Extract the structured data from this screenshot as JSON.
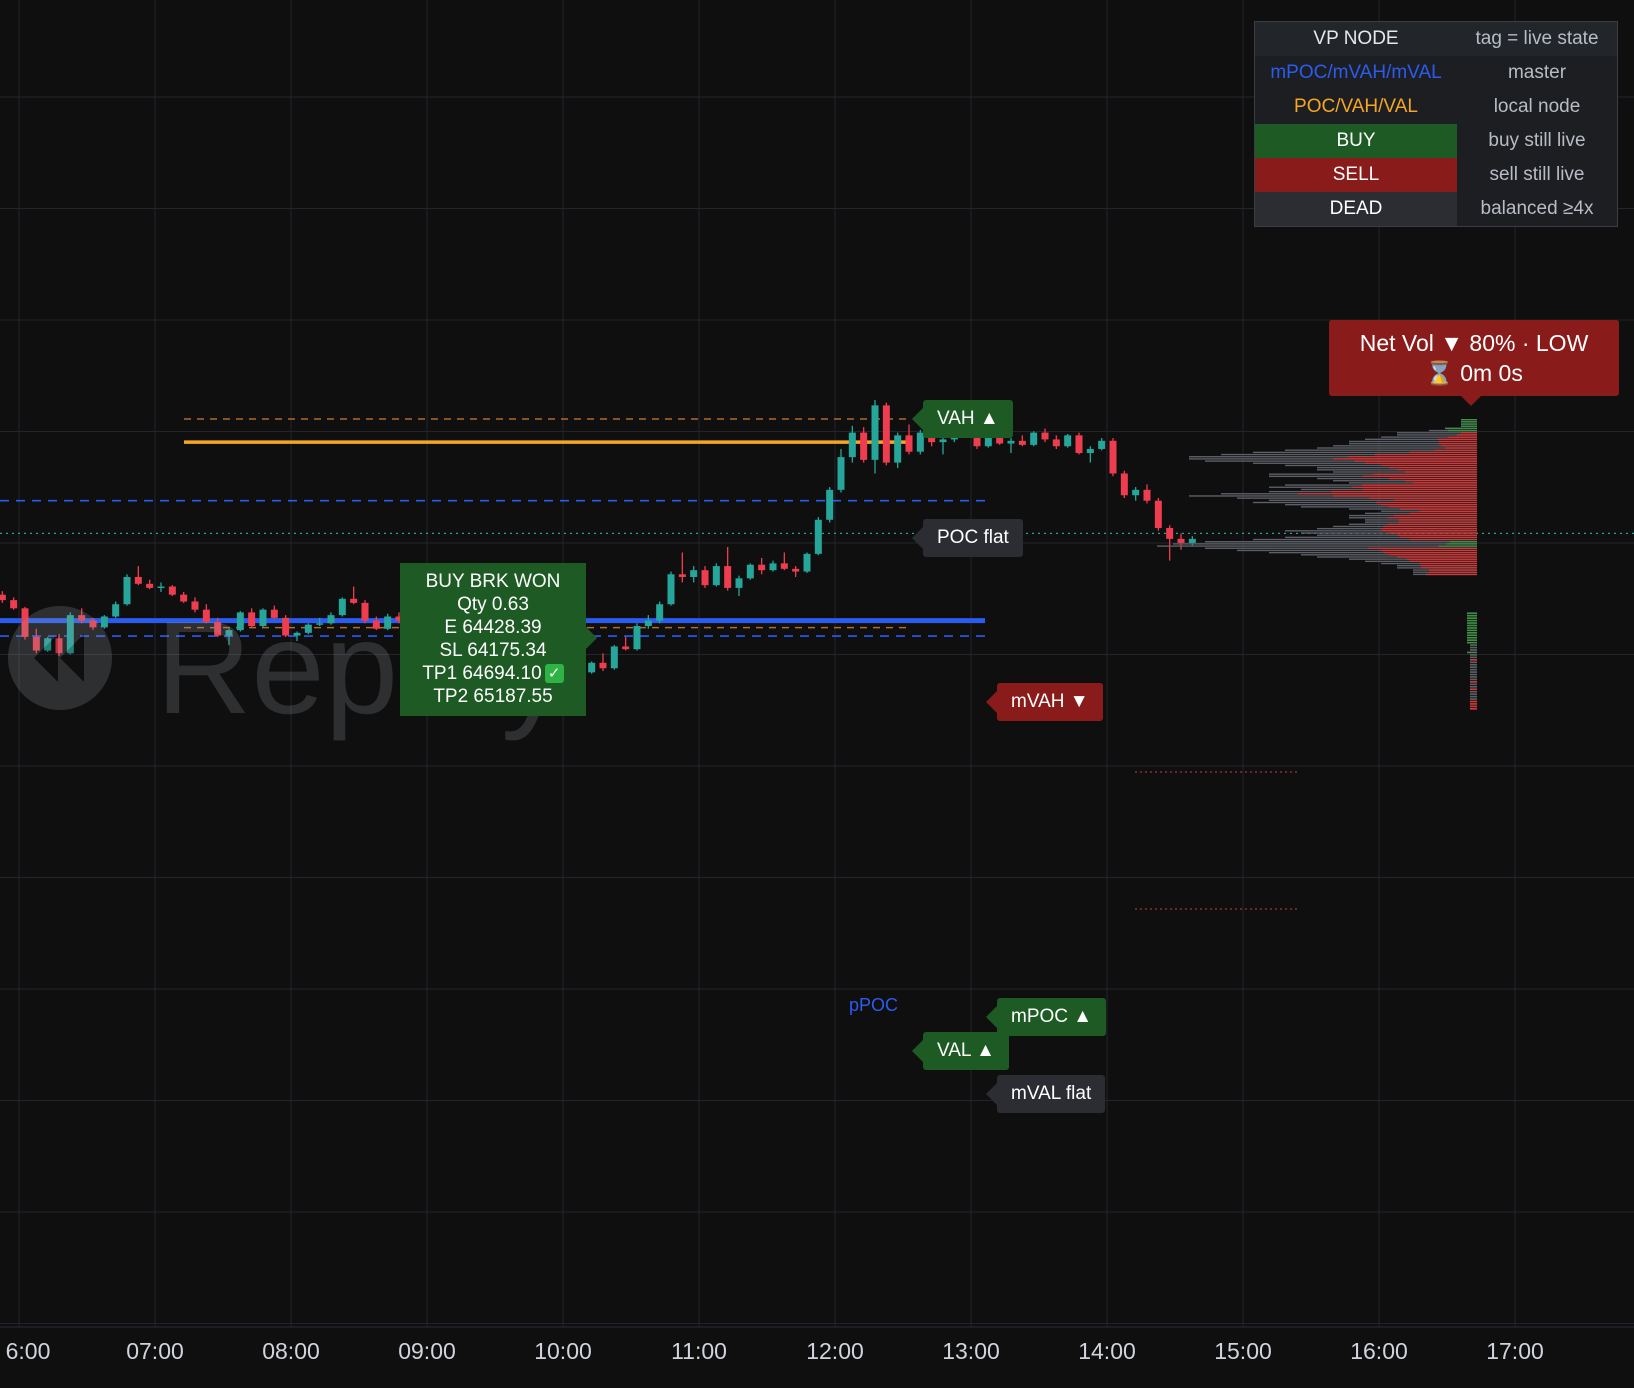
{
  "chart_data": {
    "type": "candlestick",
    "x_ticks": [
      "6:00",
      "07:00",
      "08:00",
      "09:00",
      "10:00",
      "11:00",
      "12:00",
      "13:00",
      "14:00",
      "15:00",
      "16:00",
      "17:00"
    ],
    "bar_interval_minutes": 5,
    "first_bar_time": "05:40",
    "ohlc": [
      [
        64010,
        64012,
        63935,
        63940
      ],
      [
        63940,
        63995,
        63930,
        63985
      ],
      [
        63985,
        63998,
        63955,
        63965
      ],
      [
        63965,
        63975,
        63930,
        63935
      ],
      [
        63935,
        63940,
        63820,
        63830
      ],
      [
        63830,
        63860,
        63770,
        63780
      ],
      [
        63780,
        63830,
        63775,
        63825
      ],
      [
        63825,
        63840,
        63760,
        63770
      ],
      [
        63770,
        63920,
        63765,
        63910
      ],
      [
        63910,
        63935,
        63880,
        63890
      ],
      [
        63890,
        63900,
        63855,
        63865
      ],
      [
        63865,
        63910,
        63860,
        63905
      ],
      [
        63905,
        63960,
        63900,
        63950
      ],
      [
        63950,
        64060,
        63945,
        64050
      ],
      [
        64050,
        64090,
        64020,
        64025
      ],
      [
        64025,
        64040,
        64005,
        64010
      ],
      [
        64010,
        64030,
        63995,
        64015
      ],
      [
        64015,
        64020,
        63980,
        63985
      ],
      [
        63985,
        63995,
        63955,
        63960
      ],
      [
        63960,
        63975,
        63920,
        63930
      ],
      [
        63930,
        63950,
        63880,
        63885
      ],
      [
        63885,
        63900,
        63830,
        63835
      ],
      [
        63835,
        63860,
        63800,
        63855
      ],
      [
        63855,
        63925,
        63850,
        63920
      ],
      [
        63920,
        63935,
        63865,
        63870
      ],
      [
        63870,
        63935,
        63865,
        63930
      ],
      [
        63930,
        63945,
        63895,
        63900
      ],
      [
        63900,
        63910,
        63830,
        63835
      ],
      [
        63835,
        63850,
        63815,
        63845
      ],
      [
        63845,
        63880,
        63840,
        63875
      ],
      [
        63875,
        63900,
        63870,
        63880
      ],
      [
        63880,
        63920,
        63875,
        63910
      ],
      [
        63910,
        63975,
        63905,
        63970
      ],
      [
        63970,
        64015,
        63950,
        63955
      ],
      [
        63955,
        63965,
        63880,
        63890
      ],
      [
        63890,
        63905,
        63855,
        63860
      ],
      [
        63860,
        63915,
        63855,
        63905
      ],
      [
        63905,
        63920,
        63880,
        63890
      ],
      [
        63890,
        63925,
        63885,
        63920
      ],
      [
        63920,
        63960,
        63915,
        63955
      ],
      [
        63955,
        63960,
        63905,
        63910
      ],
      [
        63910,
        63915,
        63855,
        63860
      ],
      [
        63860,
        63870,
        63760,
        63770
      ],
      [
        63770,
        63780,
        63710,
        63720
      ],
      [
        63720,
        63730,
        63640,
        63650
      ],
      [
        63650,
        63660,
        63610,
        63620
      ],
      [
        63620,
        63650,
        63600,
        63640
      ],
      [
        63640,
        63660,
        63610,
        63615
      ],
      [
        63615,
        63640,
        63590,
        63630
      ],
      [
        63630,
        63650,
        63610,
        63615
      ],
      [
        63615,
        63660,
        63610,
        63655
      ],
      [
        63655,
        63670,
        63620,
        63625
      ],
      [
        63625,
        63720,
        63620,
        63715
      ],
      [
        63715,
        63730,
        63690,
        63700
      ],
      [
        63700,
        63740,
        63695,
        63735
      ],
      [
        63735,
        63770,
        63705,
        63715
      ],
      [
        63715,
        63800,
        63710,
        63795
      ],
      [
        63795,
        63830,
        63780,
        63785
      ],
      [
        63785,
        63880,
        63780,
        63870
      ],
      [
        63870,
        63910,
        63860,
        63890
      ],
      [
        63890,
        63960,
        63880,
        63950
      ],
      [
        63950,
        64070,
        63945,
        64060
      ],
      [
        64060,
        64140,
        64030,
        64050
      ],
      [
        64050,
        64090,
        64030,
        64075
      ],
      [
        64075,
        64090,
        64010,
        64020
      ],
      [
        64020,
        64100,
        64015,
        64090
      ],
      [
        64090,
        64160,
        64000,
        64010
      ],
      [
        64010,
        64055,
        63980,
        64045
      ],
      [
        64045,
        64100,
        64040,
        64095
      ],
      [
        64095,
        64120,
        64060,
        64075
      ],
      [
        64075,
        64110,
        64070,
        64100
      ],
      [
        64100,
        64140,
        64075,
        64080
      ],
      [
        64080,
        64090,
        64050,
        64070
      ],
      [
        64070,
        64140,
        64065,
        64135
      ],
      [
        64135,
        64270,
        64130,
        64260
      ],
      [
        64260,
        64380,
        64250,
        64370
      ],
      [
        64370,
        64520,
        64360,
        64490
      ],
      [
        64490,
        64605,
        64470,
        64580
      ],
      [
        64580,
        64600,
        64470,
        64480
      ],
      [
        64480,
        64700,
        64430,
        64680
      ],
      [
        64680,
        64690,
        64460,
        64470
      ],
      [
        64470,
        64580,
        64450,
        64570
      ],
      [
        64570,
        64610,
        64500,
        64510
      ],
      [
        64510,
        64590,
        64500,
        64580
      ],
      [
        64580,
        64595,
        64530,
        64545
      ],
      [
        64545,
        64565,
        64500,
        64555
      ],
      [
        64555,
        64600,
        64545,
        64590
      ],
      [
        64590,
        64620,
        64560,
        64575
      ],
      [
        64575,
        64580,
        64520,
        64530
      ],
      [
        64530,
        64575,
        64525,
        64570
      ],
      [
        64570,
        64600,
        64535,
        64540
      ],
      [
        64540,
        64560,
        64505,
        64550
      ],
      [
        64550,
        64570,
        64530,
        64535
      ],
      [
        64535,
        64585,
        64530,
        64580
      ],
      [
        64580,
        64595,
        64545,
        64555
      ],
      [
        64555,
        64570,
        64520,
        64530
      ],
      [
        64530,
        64575,
        64525,
        64570
      ],
      [
        64570,
        64580,
        64500,
        64505
      ],
      [
        64505,
        64530,
        64470,
        64520
      ],
      [
        64520,
        64560,
        64515,
        64550
      ],
      [
        64550,
        64560,
        64420,
        64430
      ],
      [
        64430,
        64440,
        64340,
        64350
      ],
      [
        64350,
        64380,
        64330,
        64370
      ],
      [
        64370,
        64390,
        64320,
        64330
      ],
      [
        64330,
        64340,
        64220,
        64230
      ],
      [
        64230,
        64240,
        64110,
        64190
      ],
      [
        64190,
        64210,
        64150,
        64175
      ],
      [
        64175,
        64200,
        64165,
        64190
      ]
    ],
    "levels": {
      "VAH": 64630,
      "POC": 64545,
      "mVAH": 64330,
      "pPOC": 63890,
      "mPOC": 63890,
      "VAL": 63864,
      "mVAL": 63833
    },
    "current_price": 64210,
    "volume_profile": {
      "price_top": 64630,
      "price_step": 8,
      "total": [
        1,
        1,
        1,
        1,
        2,
        3,
        5,
        5,
        6,
        7,
        8,
        8,
        9,
        10,
        12,
        14,
        16,
        18,
        18,
        17,
        14,
        12,
        10,
        10,
        9,
        13,
        13,
        10,
        9,
        8,
        12,
        13,
        11,
        13,
        16,
        18,
        15,
        13,
        14,
        12,
        11,
        8,
        6,
        7,
        8,
        8,
        7,
        7,
        8,
        9,
        10,
        12,
        11,
        10,
        12,
        14,
        17,
        19,
        20,
        17,
        15,
        13,
        11,
        10,
        8,
        7,
        6,
        5,
        5,
        4,
        4,
        4
      ],
      "delta_side": [
        "buy",
        "buy",
        "buy",
        "buy",
        "buy",
        "buy",
        "sell",
        "sell",
        "sell",
        "sell",
        "sell",
        "sell",
        "sell",
        "sell",
        "sell",
        "sell",
        "sell",
        "sell",
        "sell",
        "sell",
        "sell",
        "sell",
        "sell",
        "sell",
        "sell",
        "sell",
        "sell",
        "sell",
        "sell",
        "sell",
        "sell",
        "sell",
        "sell",
        "sell",
        "sell",
        "sell",
        "sell",
        "sell",
        "sell",
        "sell",
        "sell",
        "sell",
        "sell",
        "sell",
        "sell",
        "sell",
        "sell",
        "sell",
        "sell",
        "sell",
        "sell",
        "sell",
        "sell",
        "sell",
        "sell",
        "sell",
        "buy",
        "buy",
        "buy",
        "sell",
        "sell",
        "sell",
        "sell",
        "sell",
        "sell",
        "sell",
        "sell",
        "sell",
        "sell",
        "sell",
        "sell",
        "sell"
      ],
      "delta_frac": [
        1,
        1,
        1,
        1,
        1,
        0.6,
        0.2,
        0.25,
        0.3,
        0.35,
        0.3,
        0.3,
        0.25,
        0.2,
        0.22,
        0.3,
        0.4,
        0.45,
        0.5,
        0.45,
        0.5,
        0.5,
        0.55,
        0.5,
        0.5,
        0.5,
        0.55,
        0.55,
        0.5,
        0.5,
        0.6,
        0.6,
        0.65,
        0.7,
        0.7,
        0.5,
        0.45,
        0.4,
        0.45,
        0.5,
        0.5,
        0.6,
        0.6,
        0.6,
        0.65,
        0.7,
        0.7,
        0.7,
        0.7,
        0.65,
        0.6,
        0.5,
        0.5,
        0.5,
        0.4,
        0.3,
        0.1,
        0.1,
        0.12,
        0.4,
        0.4,
        0.45,
        0.5,
        0.5,
        0.55,
        0.6,
        0.6,
        0.7,
        0.7,
        0.75,
        0.75,
        0.8
      ]
    },
    "lower_delta_strip": {
      "price_top": 63920,
      "price_step": 9,
      "side": [
        "buy",
        "buy",
        "buy",
        "buy",
        "buy",
        "buy",
        "buy",
        "buy",
        "buy",
        "buy",
        "buy",
        "buy",
        "buy",
        "gray",
        "gray",
        "gray",
        "buy",
        "gray",
        "gray",
        "sell",
        "gray",
        "gray",
        "gray",
        "gray",
        "gray",
        "gray",
        "gray",
        "gray",
        "sell",
        "gray",
        "gray",
        "sell",
        "gray",
        "gray",
        "gray",
        "gray",
        "sell",
        "sell",
        "sell",
        "sell"
      ]
    }
  },
  "tags": {
    "vah": "VAH ▲",
    "poc": "POC flat",
    "mvah": "mVAH ▼",
    "mpoc": "mPOC ▲",
    "val": "VAL ▲",
    "mval": "mVAL flat",
    "ppoc": "pPOC"
  },
  "legend": {
    "header_left": "VP NODE",
    "header_right": "tag = live state",
    "rows": [
      {
        "left": "mPOC/mVAH/mVAL",
        "right": "master"
      },
      {
        "left": "POC/VAH/VAL",
        "right": "local node"
      },
      {
        "left": "BUY",
        "right": "buy still live"
      },
      {
        "left": "SELL",
        "right": "sell still live"
      },
      {
        "left": "DEAD",
        "right": "balanced ≥4x"
      }
    ]
  },
  "net_vol": {
    "line1": "Net Vol ▼ 80%  ·  LOW",
    "hourglass": "⌛",
    "line2": "0m 0s"
  },
  "trade": {
    "line1": "BUY  BRK  WON",
    "line2": "Qty 0.63",
    "line3": "E   64428.39",
    "line4": "SL  64175.34",
    "line5": "TP1 64694.10",
    "check": "✓",
    "line6": "TP2 65187.55"
  },
  "watermark": {
    "word": "Replay"
  },
  "colors": {
    "up": "#26a69a",
    "down": "#ef3d50",
    "poc": "#f5a623",
    "mpoc": "#2b5cf0",
    "vp_gray": "#5d6068",
    "vp_buy": "#3f8f47",
    "vp_sell": "#d23a3a",
    "bg": "#0f0f0f"
  }
}
